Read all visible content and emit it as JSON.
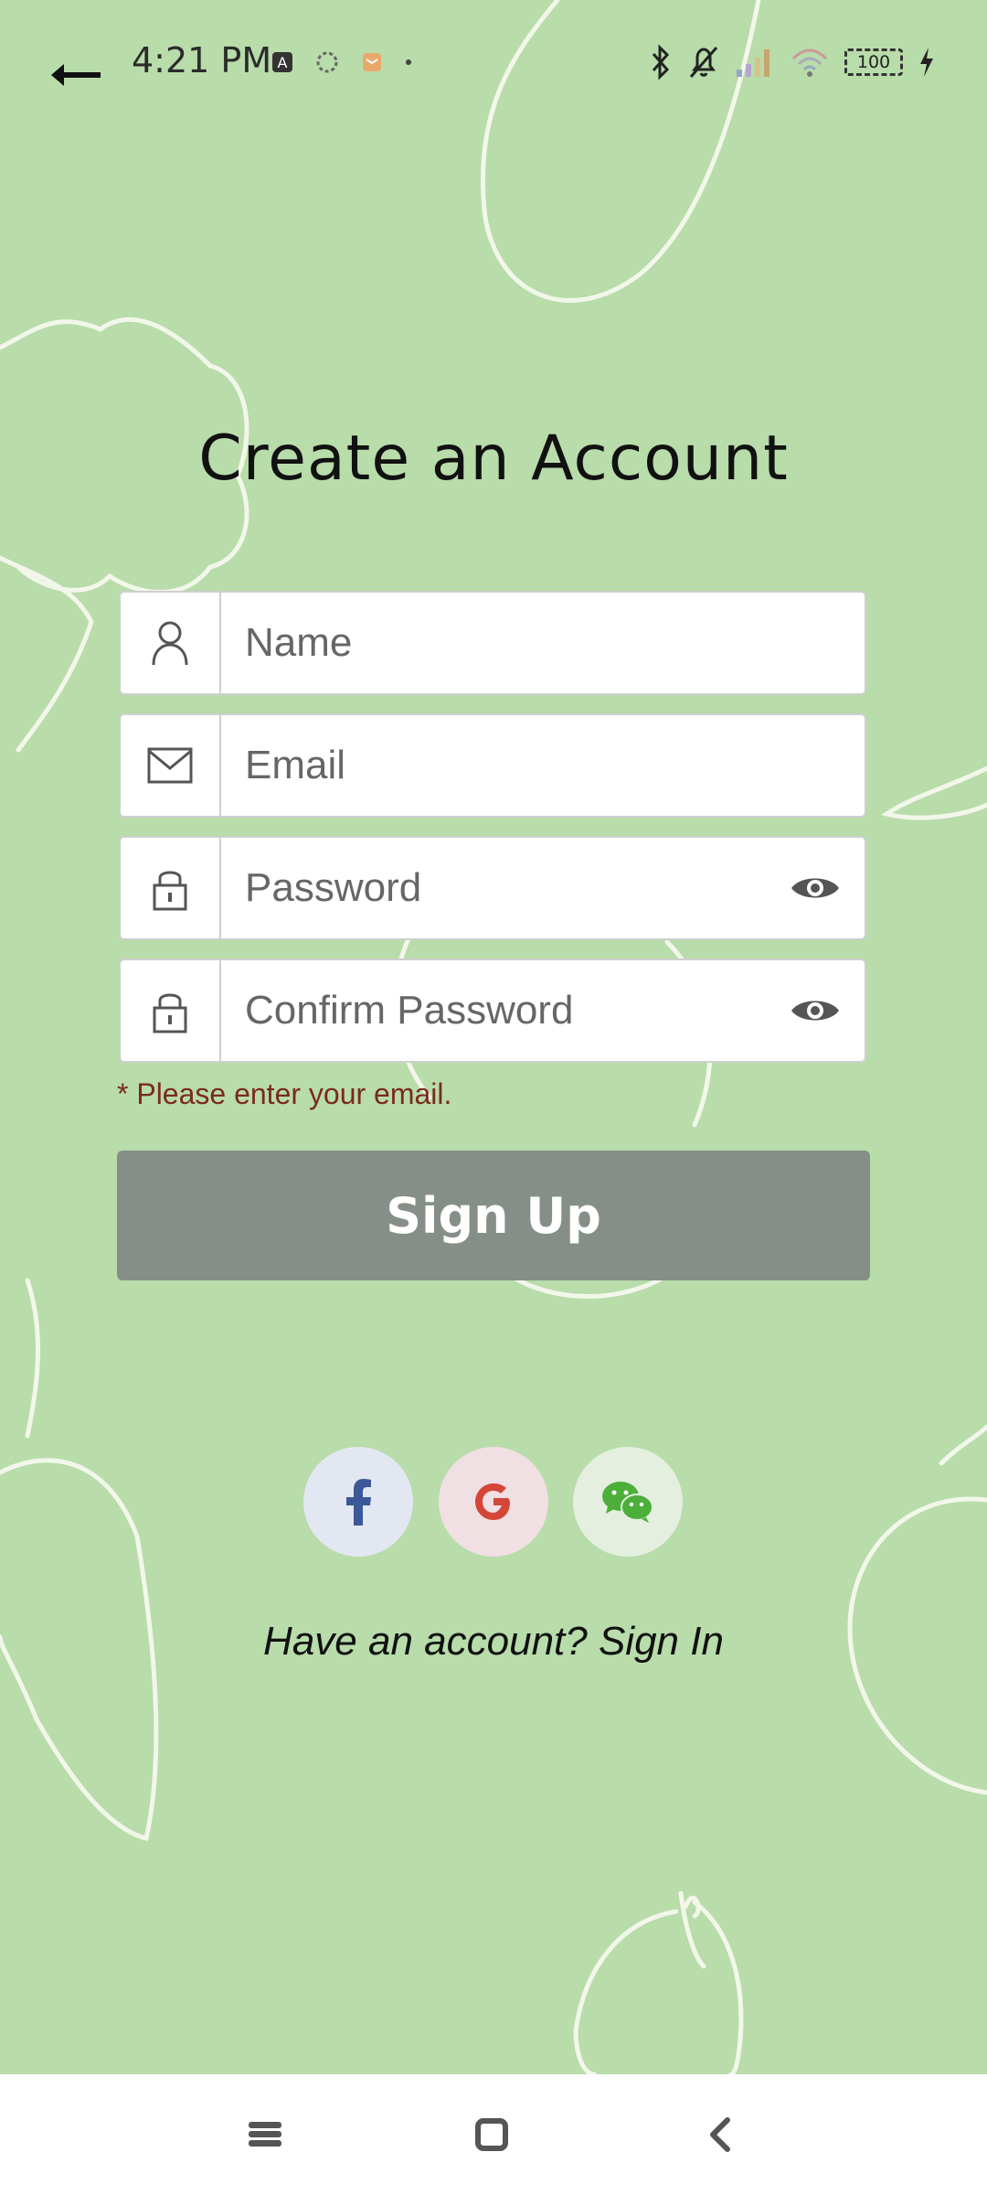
{
  "status_bar": {
    "time": "4:21 PM",
    "battery": "100",
    "left_icons": [
      "notification-a-icon",
      "circle-app-icon",
      "mail-app-icon",
      "dot-icon"
    ],
    "right_icons": [
      "bluetooth-icon",
      "silent-bell-icon",
      "signal-icon",
      "wifi-icon",
      "battery-icon",
      "charging-icon"
    ]
  },
  "header": {
    "back_icon": "back-arrow-icon"
  },
  "title": "Create an Account",
  "form": {
    "name_placeholder": "Name",
    "email_placeholder": "Email",
    "password_placeholder": "Password",
    "confirm_placeholder": "Confirm Password",
    "error": "* Please enter your email.",
    "submit_label": "Sign Up"
  },
  "social": [
    {
      "name": "facebook-icon",
      "color": "#3b5998"
    },
    {
      "name": "google-icon",
      "color": "#d44638"
    },
    {
      "name": "wechat-icon",
      "color": "#4caf3a"
    }
  ],
  "footer": {
    "signin_text": "Have an account? Sign In"
  },
  "nav_bar": {
    "icons": [
      "menu-icon",
      "home-icon",
      "back-icon"
    ]
  },
  "colors": {
    "background": "#b8dcaa",
    "button": "#858f88",
    "error": "#7a2a1e"
  }
}
